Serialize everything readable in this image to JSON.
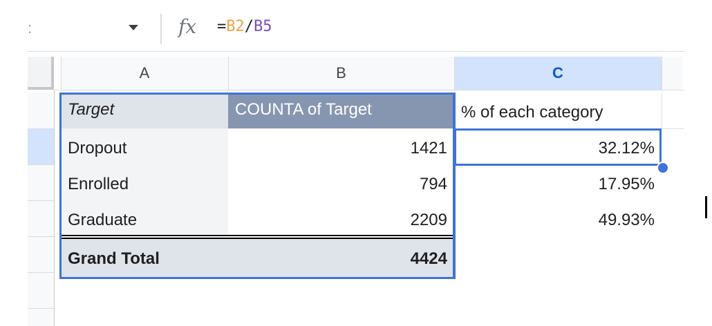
{
  "formula_bar": {
    "name_box_dropdown": "name-box-dropdown",
    "fx_label": "fx",
    "eq": "=",
    "ref1": "B2",
    "slash": "/",
    "ref2": "B5"
  },
  "columns": [
    "A",
    "B",
    "C"
  ],
  "header_row": {
    "a": "Target",
    "b": "COUNTA of Target",
    "c": "% of each category"
  },
  "rows": [
    {
      "a": "Dropout",
      "b": "1421",
      "c": "32.12%"
    },
    {
      "a": "Enrolled",
      "b": "794",
      "c": "17.95%"
    },
    {
      "a": "Graduate",
      "b": "2209",
      "c": "49.93%"
    }
  ],
  "total_row": {
    "a": "Grand Total",
    "b": "4424"
  },
  "colors": {
    "pivot_header_bg": "#8796b0",
    "pivot_label_bg": "#dfe3ea",
    "total_bg": "#dfe3ea",
    "selected_col_header": "#d3e3fd",
    "selection_border": "#3d74d6"
  }
}
